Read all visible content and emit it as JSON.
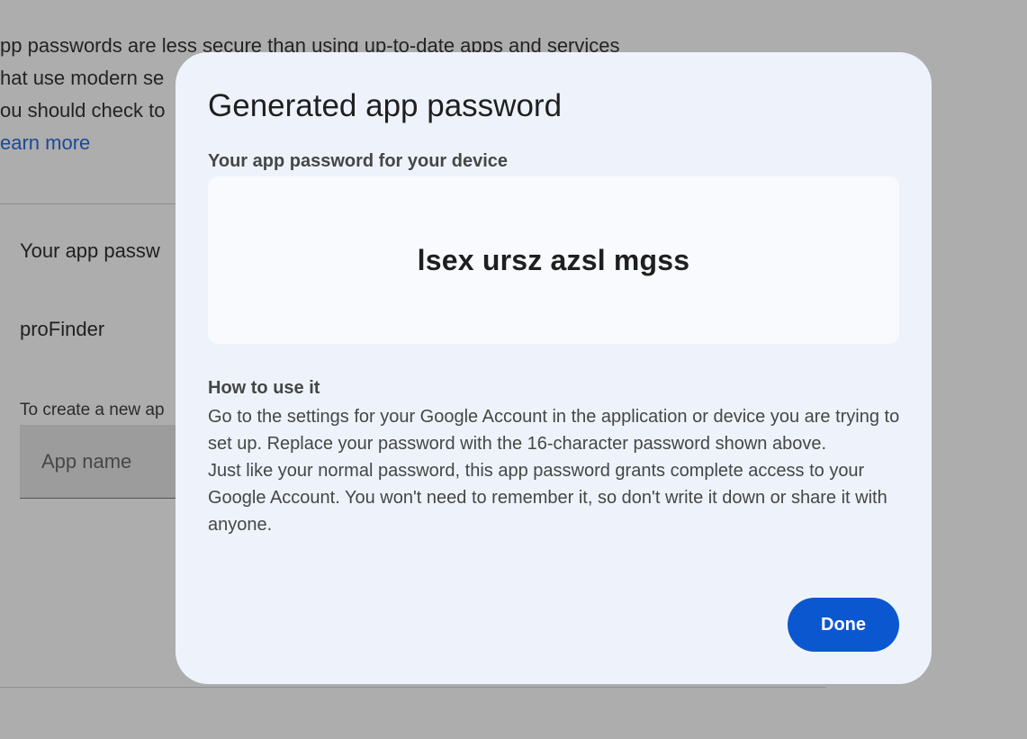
{
  "background": {
    "intro_lines": [
      "pp passwords are less secure than using up-to-date apps and services",
      "hat use modern se",
      "ou should check to"
    ],
    "learn_more": "earn more",
    "section_title": "Your app passw",
    "app_item": "proFinder",
    "create_hint": "To create a new ap",
    "app_name_placeholder": "App name"
  },
  "dialog": {
    "title": "Generated app password",
    "password_label": "Your app password for your device",
    "password": "lsex ursz azsl mgss",
    "howto_title": "How to use it",
    "howto_paragraphs": [
      "Go to the settings for your Google Account in the application or device you are trying to set up. Replace your password with the 16-character password shown above.",
      "Just like your normal password, this app password grants complete access to your Google Account. You won't need to remember it, so don't write it down or share it with anyone."
    ],
    "done_label": "Done"
  },
  "colors": {
    "scrim": "#adadad",
    "dialog_bg": "#eef3fb",
    "password_box_bg": "#f8fafe",
    "primary_button": "#0b57d0",
    "link": "#1a4a9a"
  }
}
